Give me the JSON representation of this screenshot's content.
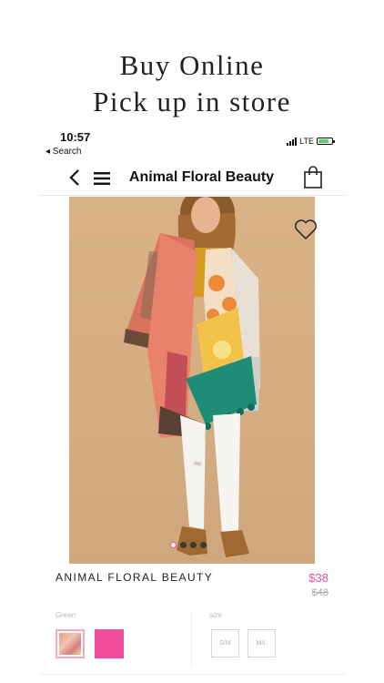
{
  "promo": {
    "line1": "Buy Online",
    "line2": "Pick up in store"
  },
  "status": {
    "time": "10:57",
    "back_app": "◂ Search",
    "network": "LTE",
    "battery_level": 0.75
  },
  "nav": {
    "title": "Animal Floral Beauty",
    "back_icon": "chevron-left-icon",
    "menu_icon": "hamburger-icon",
    "bag_icon": "shopping-bag-icon"
  },
  "product": {
    "name": "ANIMAL FLORAL BEAUTY",
    "price_sale": "$38",
    "price_original": "$48",
    "image_count": 4,
    "active_image": 0
  },
  "options": {
    "color_label": "Green",
    "size_label": "size",
    "sizes": [
      "S/M",
      "M/L"
    ]
  },
  "colors": {
    "accent_pink": "#e84e9b",
    "swatch_pink": "#ef4c9a"
  }
}
